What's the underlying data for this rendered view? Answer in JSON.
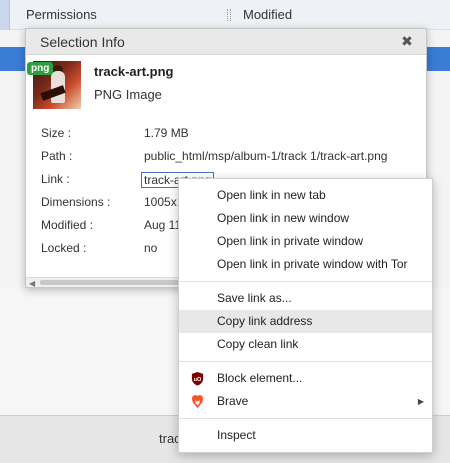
{
  "file_list": {
    "header": {
      "permissions": "Permissions",
      "modified": "Modified"
    },
    "bottom_snippet": "trac"
  },
  "dialog": {
    "title": "Selection Info",
    "close_glyph": "✖",
    "badge": "png",
    "file_name": "track-art.png",
    "file_type": "PNG Image",
    "rows": [
      {
        "label": "Size :",
        "value": "1.79 MB"
      },
      {
        "label": "Path :",
        "value": "public_html/msp/album-1/track 1/track-art.png"
      },
      {
        "label": "Link :",
        "value": "track-art.png"
      },
      {
        "label": "Dimensions :",
        "value": "1005x1"
      },
      {
        "label": "Modified :",
        "value": "Aug 11"
      },
      {
        "label": "Locked :",
        "value": "no"
      }
    ]
  },
  "context_menu": {
    "groups": [
      [
        "Open link in new tab",
        "Open link in new window",
        "Open link in private window",
        "Open link in private window with Tor"
      ],
      [
        "Save link as...",
        "Copy link address",
        "Copy clean link"
      ],
      [
        "Block element...",
        "Brave"
      ],
      [
        "Inspect"
      ]
    ],
    "hovered_item": "Copy link address",
    "icons": {
      "block_element": "ublock-origin-icon",
      "brave": "brave-lion-icon"
    },
    "colors": {
      "ublock": "#800000",
      "brave": "#fb542b"
    }
  }
}
